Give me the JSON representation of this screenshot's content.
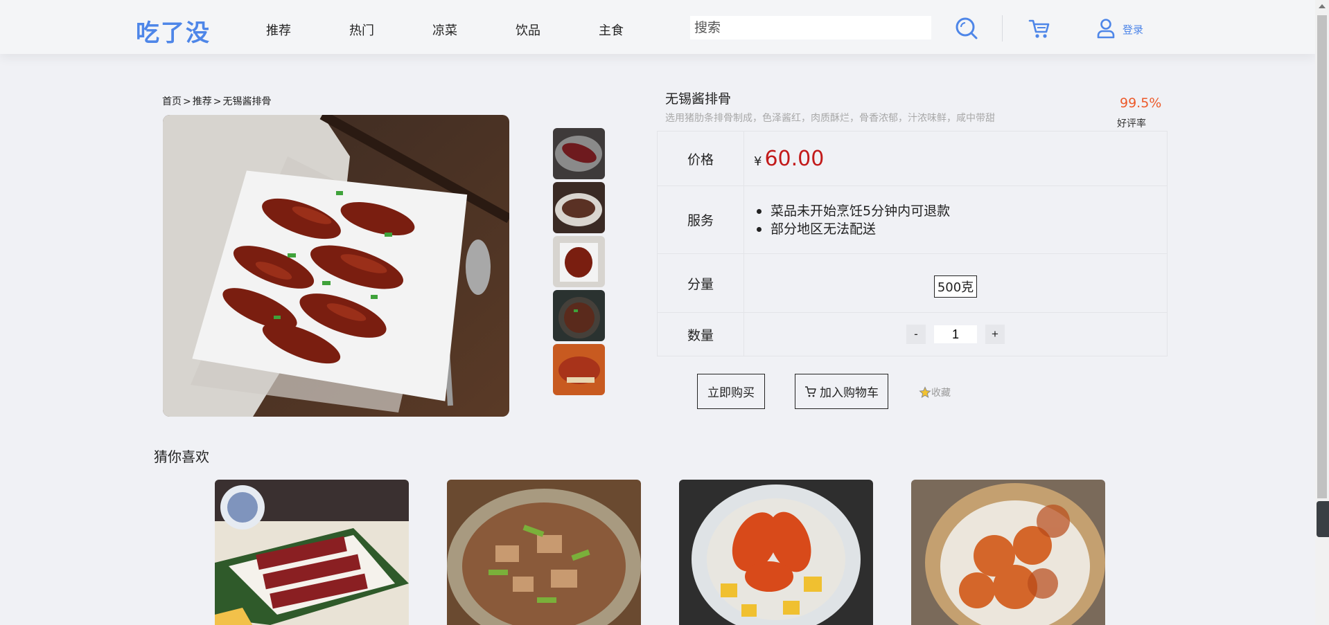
{
  "header": {
    "logo": "吃了没",
    "nav": [
      "推荐",
      "热门",
      "凉菜",
      "饮品",
      "主食"
    ],
    "search_placeholder": "搜索",
    "login_label": "登录"
  },
  "breadcrumb": [
    "首页",
    "推荐",
    "无锡酱排骨"
  ],
  "breadcrumb_separator": ">",
  "product": {
    "name": "无锡酱排骨",
    "description": "选用猪肋条排骨制成，色泽酱红，肉质酥烂，骨香浓郁，汁浓味鲜，咸中带甜",
    "rating": "99.5%",
    "rating_label": "好评率",
    "price_label": "价格",
    "currency": "¥",
    "price": "60.00",
    "service_label": "服务",
    "services": [
      "菜品未开始烹饪5分钟内可退款",
      "部分地区无法配送"
    ],
    "weight_label": "分量",
    "weight_option": "500克",
    "quantity_label": "数量",
    "quantity": "1",
    "minus": "-",
    "plus": "+"
  },
  "actions": {
    "buy_now": "立即购买",
    "add_to_cart": "加入购物车",
    "favorite": "收藏"
  },
  "recommend": {
    "title": "猜你喜欢"
  },
  "colors": {
    "brand": "#4e86e8",
    "price": "#c21a1a",
    "rating": "#ec5a2a"
  }
}
